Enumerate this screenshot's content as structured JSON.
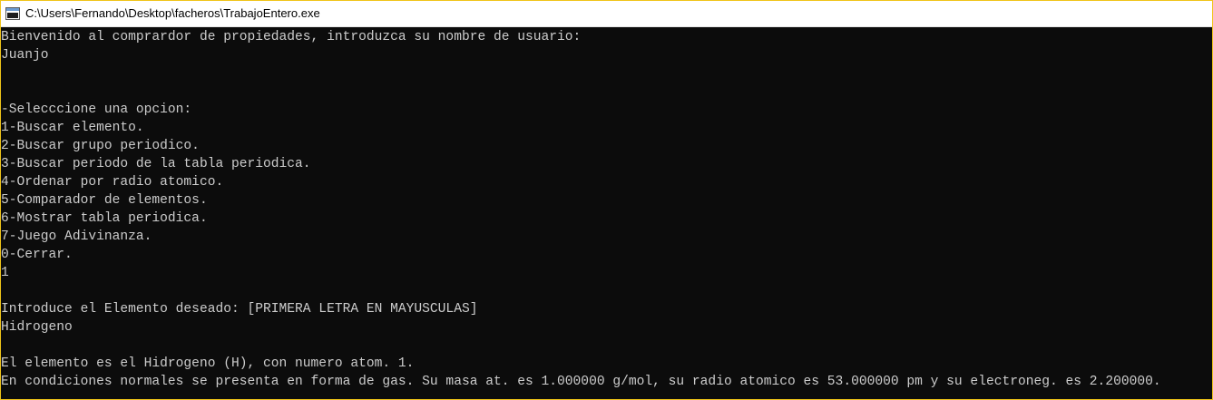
{
  "window": {
    "title": "C:\\Users\\Fernando\\Desktop\\facheros\\TrabajoEntero.exe",
    "icon": "console-app-icon"
  },
  "colors": {
    "console_bg": "#0c0c0c",
    "console_text": "#cccccc",
    "titlebar_bg": "#ffffff",
    "window_border": "#f0c419"
  },
  "console": {
    "lines": [
      "Bienvenido al comprardor de propiedades, introduzca su nombre de usuario:",
      "Juanjo",
      "",
      "",
      "-Selecccione una opcion:",
      "1-Buscar elemento.",
      "2-Buscar grupo periodico.",
      "3-Buscar periodo de la tabla periodica.",
      "4-Ordenar por radio atomico.",
      "5-Comparador de elementos.",
      "6-Mostrar tabla periodica.",
      "7-Juego Adivinanza.",
      "0-Cerrar.",
      "1",
      "",
      "Introduce el Elemento deseado: [PRIMERA LETRA EN MAYUSCULAS]",
      "Hidrogeno",
      "",
      "El elemento es el Hidrogeno (H), con numero atom. 1.",
      "En condiciones normales se presenta en forma de gas. Su masa at. es 1.000000 g/mol, su radio atomico es 53.000000 pm y su electroneg. es 2.200000."
    ]
  }
}
